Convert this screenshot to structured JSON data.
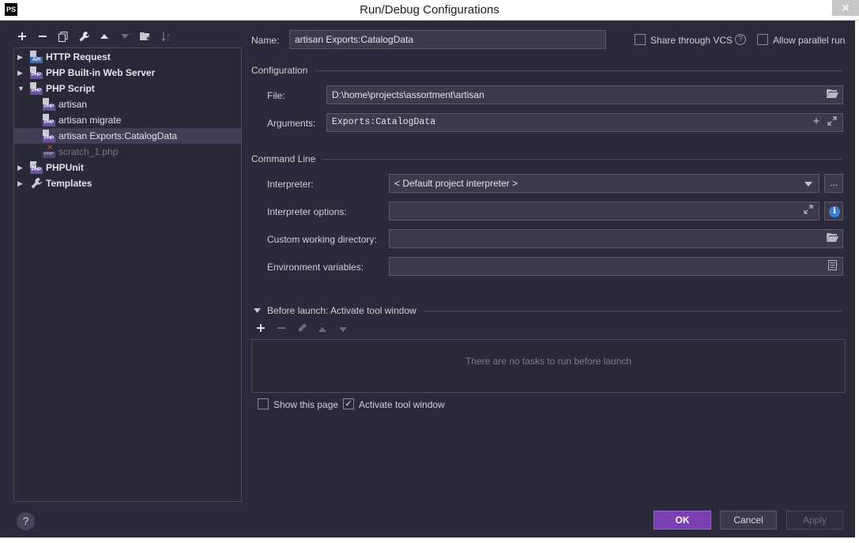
{
  "window": {
    "title": "Run/Debug Configurations",
    "app_icon": "PS",
    "close_glyph": "✕"
  },
  "tree_toolbar": {
    "icons": [
      "plus-icon",
      "minus-icon",
      "copy-icon",
      "wrench-icon",
      "arrow-up-icon",
      "arrow-down-icon",
      "new-folder-icon",
      "sort-icon"
    ]
  },
  "tree": {
    "items": [
      {
        "label": "HTTP Request",
        "icon": "api-icon",
        "arrow": "▶",
        "level": 0
      },
      {
        "label": "PHP Built-in Web Server",
        "icon": "php-icon",
        "arrow": "▶",
        "level": 0
      },
      {
        "label": "PHP Script",
        "icon": "php-icon",
        "arrow": "▼",
        "level": 0
      },
      {
        "label": "artisan",
        "icon": "php-script-icon",
        "level": 1
      },
      {
        "label": "artisan migrate",
        "icon": "php-script-icon",
        "level": 1
      },
      {
        "label": "artisan Exports:CatalogData",
        "icon": "php-script-icon",
        "level": 1,
        "selected": true
      },
      {
        "label": "scratch_1.php",
        "icon": "php-error-icon",
        "level": 1,
        "dim": true
      },
      {
        "label": "PHPUnit",
        "icon": "phpunit-icon",
        "arrow": "▶",
        "level": 0
      },
      {
        "label": "Templates",
        "icon": "wrench-icon",
        "arrow": "▶",
        "level": 0
      }
    ],
    "php_badge": "PHP",
    "api_badge": "API"
  },
  "form": {
    "name_label": "Name:",
    "name_value": "artisan Exports:CatalogData",
    "share_vcs_label": "Share through VCS",
    "share_vcs_checked": false,
    "share_vcs_help": "?",
    "allow_parallel_label": "Allow parallel run",
    "allow_parallel_checked": false,
    "configuration_section": "Configuration",
    "file_label": "File:",
    "file_value": "D:\\home\\projects\\assortment\\artisan",
    "arguments_label": "Arguments:",
    "arguments_value": "Exports:CatalogData",
    "command_line_section": "Command Line",
    "interpreter_label": "Interpreter:",
    "interpreter_value": "< Default project interpreter >",
    "interpreter_more": "...",
    "interpreter_options_label": "Interpreter options:",
    "interpreter_options_value": "",
    "info_glyph": "i",
    "working_dir_label": "Custom working directory:",
    "working_dir_value": "",
    "env_vars_label": "Environment variables:",
    "env_vars_value": ""
  },
  "before_launch": {
    "title": "Before launch: Activate tool window",
    "toolbar_icons": [
      "plus-icon",
      "minus-icon",
      "pencil-icon",
      "arrow-up-icon",
      "arrow-down-icon"
    ],
    "empty_message": "There are no tasks to run before launch",
    "show_page_label": "Show this page",
    "show_page_checked": false,
    "activate_tool_label": "Activate tool window",
    "activate_tool_checked": true,
    "check_glyph": "✓"
  },
  "footer": {
    "help_glyph": "?",
    "ok_label": "OK",
    "cancel_label": "Cancel",
    "apply_label": "Apply"
  },
  "colors": {
    "background": "#2b2a3a",
    "field_bg": "#3c3b4c",
    "selection": "#3f3e52",
    "primary_button": "#7a3fb0",
    "info_blue": "#3d7fd6"
  }
}
